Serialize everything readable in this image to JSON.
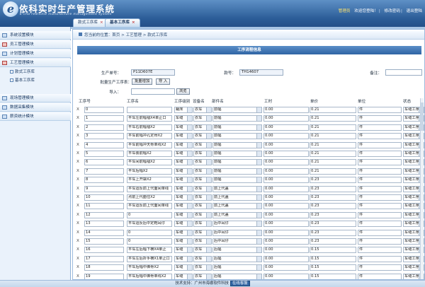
{
  "header": {
    "logo_letter": "e",
    "title": "依科实时生产管理系统",
    "subtitle": "E-cho realtime manufacture management system",
    "links": [
      "管理员",
      "欢迎您登陆！",
      "修改密码",
      "退出登陆"
    ],
    "separator": "|"
  },
  "tabs": [
    {
      "label": "款式工序库",
      "close": "×"
    },
    {
      "label": "基本工序库",
      "close": "×"
    }
  ],
  "sidebar": {
    "items": [
      {
        "label": "系统设置模块"
      },
      {
        "label": "员工管理模块"
      },
      {
        "label": "计划管理模块"
      },
      {
        "label": "工艺管理模块"
      },
      {
        "label": "款式工序库",
        "sub": true
      },
      {
        "label": "基本工序库",
        "sub": true
      },
      {
        "label": "现场管理模块"
      },
      {
        "label": "数据采集模块"
      },
      {
        "label": "薪资统计模块"
      }
    ]
  },
  "breadcrumb": "您当前的位置：首页 > 工艺管理 > 款式工序库",
  "form": {
    "title": "工序流程信息",
    "order_label": "生产单号：",
    "order_value": "P11D607E",
    "style_label": "款号：",
    "style_value": "TH14607",
    "remark_label": "备注：",
    "remark_value": "",
    "batch_label": "批量生产工序表：",
    "batch_add": "批量增加",
    "batch_import": "导 入",
    "import_label": "导入：",
    "import_value": "",
    "browse": "浏览"
  },
  "grid": {
    "columns": [
      "工序号",
      "工序名",
      "工序级别",
      "设备名",
      "部件名",
      "工时",
      "单价",
      "单位",
      "状态"
    ],
    "rows": [
      {
        "no": "0",
        "name": "",
        "level": "裁床",
        "equip": "衣车",
        "part": "前幅",
        "time": "0.00",
        "price": "0.21",
        "unit": "件",
        "status": "车缝工序"
      },
      {
        "no": "1",
        "name": "平车左前幅褶X4单止口",
        "level": "车缝",
        "equip": "衣车",
        "part": "前幅",
        "time": "0.00",
        "price": "0.21",
        "unit": "件",
        "status": "车缝工序"
      },
      {
        "no": "2",
        "name": "平车右前幅褶X2",
        "level": "车缝",
        "equip": "衣车",
        "part": "前幅",
        "time": "0.00",
        "price": "0.21",
        "unit": "件",
        "status": "车缝工序"
      },
      {
        "no": "3",
        "name": "平车前幅冲孔定骨X2",
        "level": "车缝",
        "equip": "衣车",
        "part": "前幅",
        "time": "0.00",
        "price": "0.21",
        "unit": "件",
        "status": "车缝工序"
      },
      {
        "no": "4",
        "name": "平车前幅冲天骨单线X2",
        "level": "车缝",
        "equip": "衣车",
        "part": "前幅",
        "time": "0.00",
        "price": "0.21",
        "unit": "件",
        "status": "车缝工序"
      },
      {
        "no": "5",
        "name": "平车装前幅X2",
        "level": "车缝",
        "equip": "衣车",
        "part": "前幅",
        "time": "0.00",
        "price": "0.21",
        "unit": "件",
        "status": "车缝工序"
      },
      {
        "no": "6",
        "name": "平车间前幅褶X2",
        "level": "车缝",
        "equip": "衣车",
        "part": "前幅",
        "time": "0.00",
        "price": "0.21",
        "unit": "件",
        "status": "车缝工序"
      },
      {
        "no": "7",
        "name": "平车后幅X2",
        "level": "车缝",
        "equip": "衣车",
        "part": "前幅",
        "time": "0.00",
        "price": "0.21",
        "unit": "件",
        "status": "车缝工序"
      },
      {
        "no": "8",
        "name": "平车上开袋X2",
        "level": "车缝",
        "equip": "衣车",
        "part": "前幅",
        "time": "0.00",
        "price": "0.23",
        "unit": "件",
        "status": "车缝工序"
      },
      {
        "no": "9",
        "name": "平车运反前上代面间单线",
        "level": "车缝",
        "equip": "衣车",
        "part": "前上代盖",
        "time": "0.00",
        "price": "0.23",
        "unit": "件",
        "status": "车缝工序"
      },
      {
        "no": "10",
        "name": "点前上代面住X2",
        "level": "车缝",
        "equip": "衣车",
        "part": "前上代盖",
        "time": "0.00",
        "price": "0.23",
        "unit": "件",
        "status": "车缝工序"
      },
      {
        "no": "11",
        "name": "平车运反前上代面间单线",
        "level": "车缝",
        "equip": "衣车",
        "part": "前上代盖",
        "time": "0.00",
        "price": "0.23",
        "unit": "件",
        "status": "车缝工序"
      },
      {
        "no": "12",
        "name": "0",
        "level": "车缝",
        "equip": "衣车",
        "part": "前上代盖",
        "time": "0.00",
        "price": "0.23",
        "unit": "件",
        "status": "车缝工序"
      },
      {
        "no": "13",
        "name": "平车运反后中定鞋耳仔",
        "level": "车缝",
        "equip": "衣车",
        "part": "后中耳仔",
        "time": "0.00",
        "price": "0.23",
        "unit": "件",
        "status": "车缝工序"
      },
      {
        "no": "14",
        "name": "0",
        "level": "车缝",
        "equip": "衣车",
        "part": "后中耳仔",
        "time": "0.00",
        "price": "0.23",
        "unit": "件",
        "status": "车缝工序"
      },
      {
        "no": "15",
        "name": "0",
        "level": "车缝",
        "equip": "衣车",
        "part": "后中耳仔",
        "time": "0.00",
        "price": "0.23",
        "unit": "件",
        "status": "车缝工序"
      },
      {
        "no": "16",
        "name": "平车左后幅下横X4单止",
        "level": "车缝",
        "equip": "衣车",
        "part": "后幅",
        "time": "0.00",
        "price": "0.15",
        "unit": "件",
        "status": "车缝工序"
      },
      {
        "no": "17",
        "name": "平车左后折手横X1单止口",
        "level": "车缝",
        "equip": "衣车",
        "part": "后幅",
        "time": "0.00",
        "price": "0.15",
        "unit": "件",
        "status": "车缝工序"
      },
      {
        "no": "18",
        "name": "平车后幅中裤骨X2",
        "level": "车缝",
        "equip": "衣车",
        "part": "后幅",
        "time": "0.00",
        "price": "0.15",
        "unit": "件",
        "status": "车缝工序"
      },
      {
        "no": "19",
        "name": "平车后幅中裤骨单线X2",
        "level": "车缝",
        "equip": "衣车",
        "part": "后幅",
        "time": "0.00",
        "price": "0.15",
        "unit": "件",
        "status": "车缝工序"
      }
    ]
  },
  "footer": {
    "text": "技术支持：广州市海睿软件科技",
    "badge": "在线客服"
  }
}
